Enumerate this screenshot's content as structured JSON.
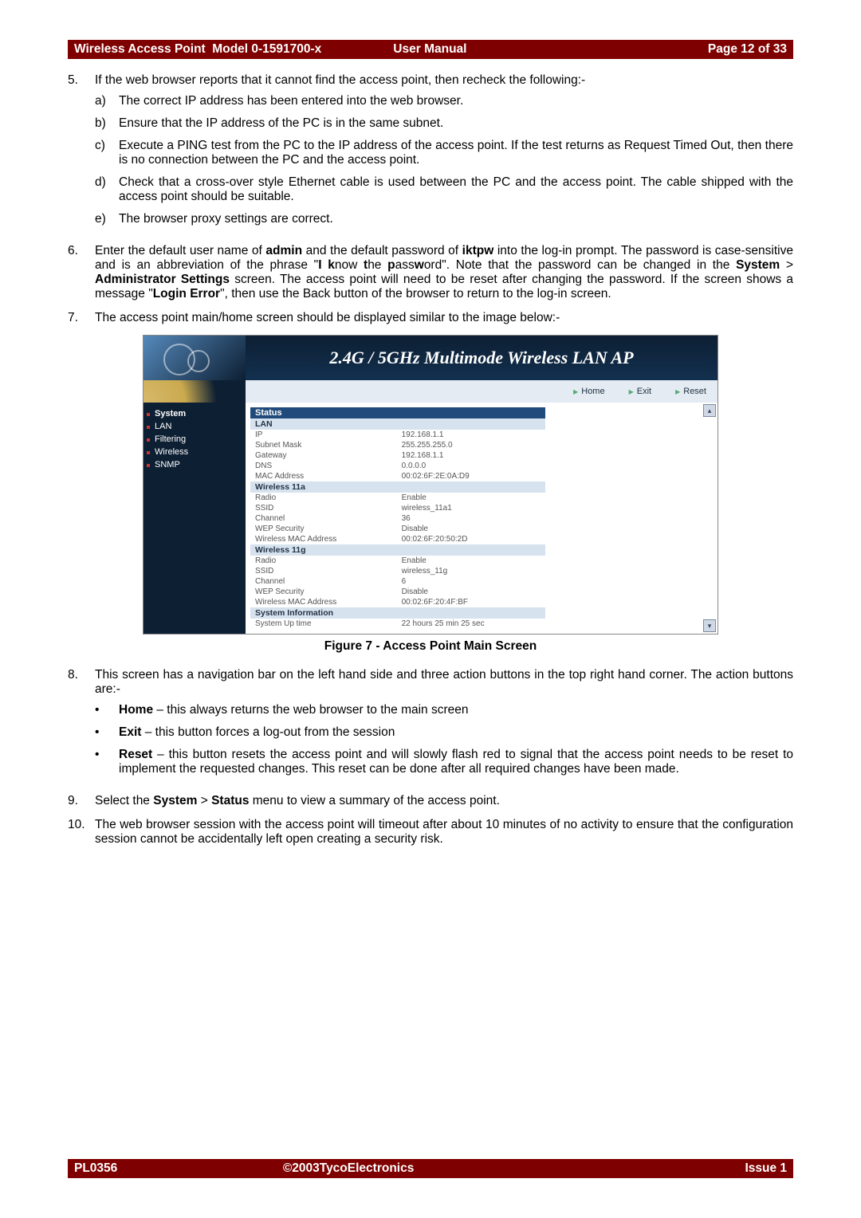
{
  "header": {
    "left": "Wireless Access Point  Model 0-1591700-x",
    "mid": "User Manual",
    "right": "Page 12 of 33"
  },
  "footer": {
    "left": "PL0356",
    "mid": "©2003TycoElectronics",
    "right": "Issue 1"
  },
  "items": {
    "n5": "5.",
    "t5": "If the web browser reports that it cannot find the access point, then recheck the following:-",
    "n5a": "a)",
    "t5a": "The correct IP address has been entered into the web browser.",
    "n5b": "b)",
    "t5b": "Ensure that the IP address of the PC is in the same subnet.",
    "n5c": "c)",
    "t5c": "Execute a PING test from the PC to the IP address of the access point. If the test returns as Request Timed Out, then there is no connection between the PC and the access point.",
    "n5d": "d)",
    "t5d": "Check that a cross-over style Ethernet cable is used between the PC and the access point. The cable shipped with the access point should be suitable.",
    "n5e": "e)",
    "t5e": "The browser proxy settings are correct.",
    "n6": "6.",
    "t6a": "Enter the default user name of ",
    "t6b": "admin",
    "t6c": " and the default password of ",
    "t6d": "iktpw",
    "t6e": " into the log-in prompt. The password is case-sensitive and is an abbreviation of the phrase \"",
    "t6f": "I k",
    "t6g": "now ",
    "t6h": "t",
    "t6i": "he ",
    "t6j": "p",
    "t6k": "ass",
    "t6l": "w",
    "t6m": "ord\". Note that the password can be changed in the ",
    "t6n": "System",
    "t6o": " > ",
    "t6p": "Administrator Settings",
    "t6q": " screen. The access point will need to be reset after changing the password. If the screen shows a message \"",
    "t6r": "Login Error",
    "t6s": "\", then use the Back button of the browser to return to the log-in screen.",
    "n7": "7.",
    "t7": "The access point main/home screen should be displayed similar to the image below:-",
    "n8": "8.",
    "t8": "This screen has a navigation bar on the left hand side and three action buttons in the top right hand corner. The action buttons are:-",
    "b1a": "Home",
    "b1b": " – this always returns the web browser to the main screen",
    "b2a": "Exit",
    "b2b": " – this button forces a log-out from the session",
    "b3a": "Reset",
    "b3b": " – this button resets the access point and will slowly flash red to signal that the access point needs to be reset to implement the requested changes. This reset can be done after all required changes have been made.",
    "n9": "9.",
    "t9a": "Select the ",
    "t9b": "System",
    "t9c": " > ",
    "t9d": "Status",
    "t9e": " menu to view a summary of the access point.",
    "n10": "10.",
    "t10": "The web browser session with the access point will timeout after about 10 minutes of no activity to ensure that the configuration session cannot be accidentally left open creating a security risk."
  },
  "figcaption": "Figure 7 - Access Point Main Screen",
  "ap": {
    "title": "2.4G / 5GHz Multimode Wireless LAN AP",
    "btn_home": "Home",
    "btn_exit": "Exit",
    "btn_reset": "Reset",
    "nav": {
      "system": "System",
      "lan": "LAN",
      "filtering": "Filtering",
      "wireless": "Wireless",
      "snmp": "SNMP"
    },
    "status": "Status",
    "sec_lan": "LAN",
    "lan": {
      "ip_l": "IP",
      "ip_v": "192.168.1.1",
      "sm_l": "Subnet Mask",
      "sm_v": "255.255.255.0",
      "gw_l": "Gateway",
      "gw_v": "192.168.1.1",
      "dns_l": "DNS",
      "dns_v": "0.0.0.0",
      "mac_l": "MAC Address",
      "mac_v": "00:02:6F:2E:0A:D9"
    },
    "sec_11a": "Wireless  11a",
    "w11a": {
      "radio_l": "Radio",
      "radio_v": "Enable",
      "ssid_l": "SSID",
      "ssid_v": "wireless_11a1",
      "ch_l": "Channel",
      "ch_v": "36",
      "wep_l": "WEP Security",
      "wep_v": "Disable",
      "wmac_l": "Wireless MAC Address",
      "wmac_v": "00:02:6F:20:50:2D"
    },
    "sec_11g": "Wireless  11g",
    "w11g": {
      "radio_l": "Radio",
      "radio_v": "Enable",
      "ssid_l": "SSID",
      "ssid_v": "wireless_11g",
      "ch_l": "Channel",
      "ch_v": "6",
      "wep_l": "WEP Security",
      "wep_v": "Disable",
      "wmac_l": "Wireless MAC Address",
      "wmac_v": "00:02:6F:20:4F:BF"
    },
    "sec_sys": "System  Information",
    "sys": {
      "up_l": "System Up time",
      "up_v": "22 hours 25 min 25 sec"
    }
  }
}
